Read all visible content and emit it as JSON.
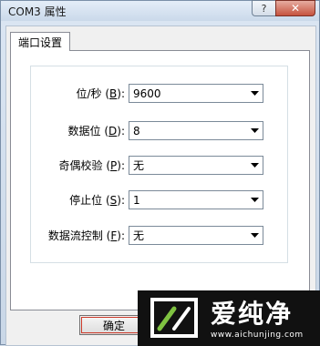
{
  "window": {
    "title": "COM3 属性",
    "help_glyph": "?",
    "close_glyph": "✕"
  },
  "tab": {
    "label": "端口设置"
  },
  "settings": [
    {
      "label_pre": "位/秒 (",
      "hotkey": "B",
      "label_post": "):",
      "value": "9600"
    },
    {
      "label_pre": "数据位 (",
      "hotkey": "D",
      "label_post": "):",
      "value": "8"
    },
    {
      "label_pre": "奇偶校验 (",
      "hotkey": "P",
      "label_post": "):",
      "value": "无"
    },
    {
      "label_pre": "停止位 (",
      "hotkey": "S",
      "label_post": "):",
      "value": "1"
    },
    {
      "label_pre": "数据流控制 (",
      "hotkey": "F",
      "label_post": "):",
      "value": "无"
    }
  ],
  "buttons": {
    "ok_label": "确定"
  },
  "watermark": {
    "brand": "爱纯净",
    "url": "www.aichunjing.com"
  }
}
